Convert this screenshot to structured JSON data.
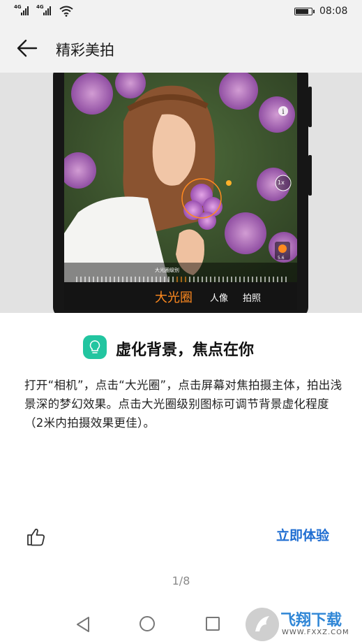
{
  "status_bar": {
    "sim1_label": "4G",
    "sim2_label": "4G",
    "battery_level": 0.9,
    "time": "08:08"
  },
  "header": {
    "back_icon": "arrow-left-icon",
    "title": "精彩美拍"
  },
  "preview": {
    "aperture_level_label": "大光圈级别",
    "modes": [
      "大光圈",
      "人像",
      "拍照"
    ],
    "active_mode": "大光圈",
    "zoom": "1x",
    "aperture_value": "5.6",
    "accent": "#ff8a1f"
  },
  "feature": {
    "icon": "lightbulb-icon",
    "icon_color": "#22c5a0",
    "headline": "虚化背景，焦点在你",
    "description": "打开“相机”，点击“大光圈”，点击屏幕对焦拍摄主体，拍出浅景深的梦幻效果。点击大光圈级别图标可调节背景虚化程度（2米内拍摄效果更佳）。"
  },
  "actions": {
    "like_icon": "thumbs-up-icon",
    "try_label": "立即体验",
    "try_color": "#1f6dd1"
  },
  "pager": {
    "text": "1/8"
  },
  "nav": {
    "back_icon": "triangle-back-icon",
    "home_icon": "circle-home-icon",
    "recent_icon": "square-recent-icon"
  },
  "watermark": {
    "text": "飞翔下载",
    "url": "WWW.FXXZ.COM"
  }
}
